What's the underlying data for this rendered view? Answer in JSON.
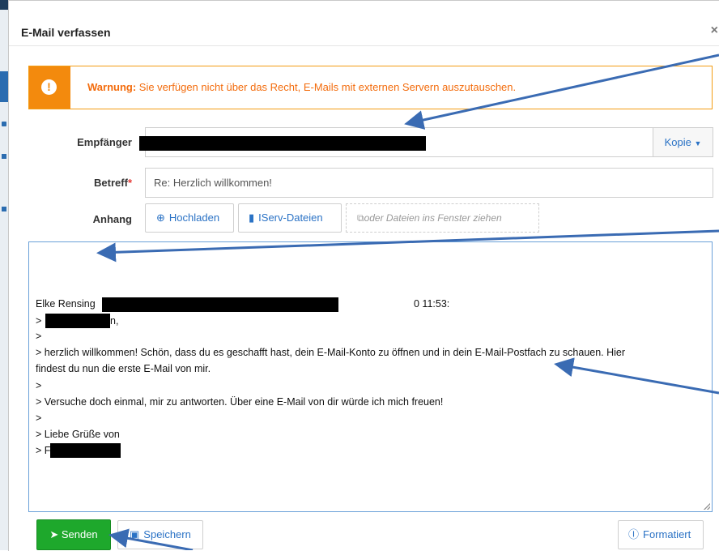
{
  "dialog": {
    "title": "E-Mail verfassen",
    "close": "×"
  },
  "warning": {
    "icon": "exclamation-icon",
    "title": "Warnung:",
    "text": " Sie verfügen nicht über das Recht, E-Mails mit externen Servern auszutauschen."
  },
  "form": {
    "recipient_label": "Empfänger",
    "copy_label": "Kopie",
    "subject_label": "Betreff",
    "required_mark": "*",
    "subject_value": "Re: Herzlich willkommen!",
    "attachment_label": "Anhang",
    "upload_label": "Hochladen",
    "iserv_files_label": "IServ-Dateien",
    "drop_label": "oder Dateien ins Fenster ziehen"
  },
  "body": {
    "lines": [
      "Elke Rensing",
      "0 11:53:",
      ">",
      "n,",
      ">",
      "> herzlich willkommen! Schön, dass du es geschafft hast, dein E-Mail-Konto zu öffnen und in dein E-Mail-Postfach zu schauen. Hier",
      "findest du nun die erste E-Mail von mir.",
      ">",
      "> Versuche doch einmal, mir zu antworten. Über eine E-Mail von dir würde ich mich freuen!",
      ">",
      "> Liebe Grüße von",
      "> F"
    ]
  },
  "footer": {
    "send_label": "Senden",
    "save_label": "Speichern",
    "format_label": "Formatiert"
  },
  "colors": {
    "warning": "#f38a0d",
    "send": "#1ea82c",
    "link": "#2a72c5",
    "arrow": "#3a6bb3"
  }
}
